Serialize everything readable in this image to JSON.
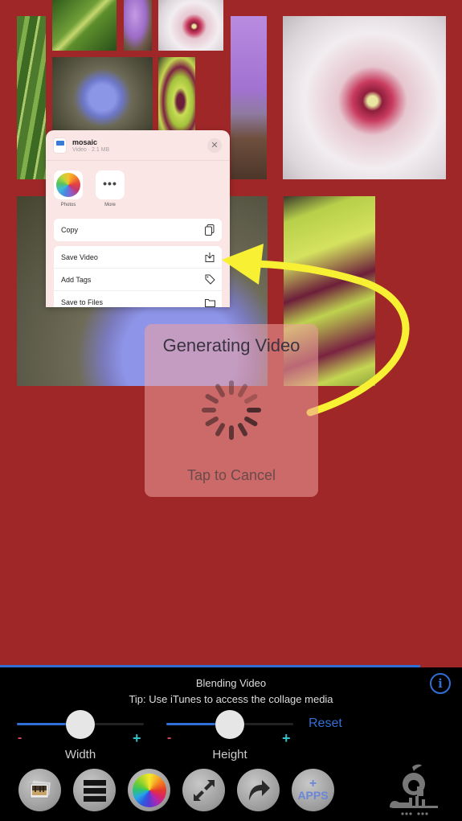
{
  "share_sheet": {
    "file_name": "mosaic",
    "file_subtitle": "Video · 2.1 MB",
    "close_icon": "close-icon",
    "apps": [
      {
        "label": "Photos",
        "icon": "photos-icon"
      },
      {
        "label": "More",
        "icon": "more-icon"
      }
    ],
    "actions_primary": [
      {
        "label": "Copy",
        "icon": "copy-icon"
      }
    ],
    "actions_secondary": [
      {
        "label": "Save Video",
        "icon": "save-download-icon"
      },
      {
        "label": "Add Tags",
        "icon": "tag-icon"
      },
      {
        "label": "Save to Files",
        "icon": "folder-icon"
      }
    ]
  },
  "generating_overlay": {
    "title": "Generating Video",
    "cancel_label": "Tap to Cancel"
  },
  "annotation": {
    "arrow_color": "#f7f033",
    "target": "Save Video"
  },
  "panel": {
    "progress_percent": 91,
    "status": "Blending Video",
    "tip": "Tip: Use iTunes to access the collage media",
    "info_icon": "info-icon",
    "sliders": [
      {
        "label": "Width",
        "value_fraction": 0.5,
        "minus": "-",
        "plus": "+"
      },
      {
        "label": "Height",
        "value_fraction": 0.5,
        "minus": "-",
        "plus": "+"
      }
    ],
    "reset_label": "Reset",
    "tools": [
      {
        "name": "photos-tool",
        "icon": "photo-stack-icon"
      },
      {
        "name": "layout-tool",
        "icon": "rows-layout-icon"
      },
      {
        "name": "color-tool",
        "icon": "color-wheel-icon"
      },
      {
        "name": "resize-tool",
        "icon": "resize-arrows-icon"
      },
      {
        "name": "share-tool",
        "icon": "share-arrow-icon"
      },
      {
        "name": "more-apps-tool",
        "label": "APPS",
        "plus": "+",
        "icon": "apps-icon"
      }
    ]
  },
  "colors": {
    "background": "#9f2727",
    "accent_blue": "#2f6fd6",
    "minus_red": "#d84a5a",
    "plus_cyan": "#2fc0c8"
  }
}
